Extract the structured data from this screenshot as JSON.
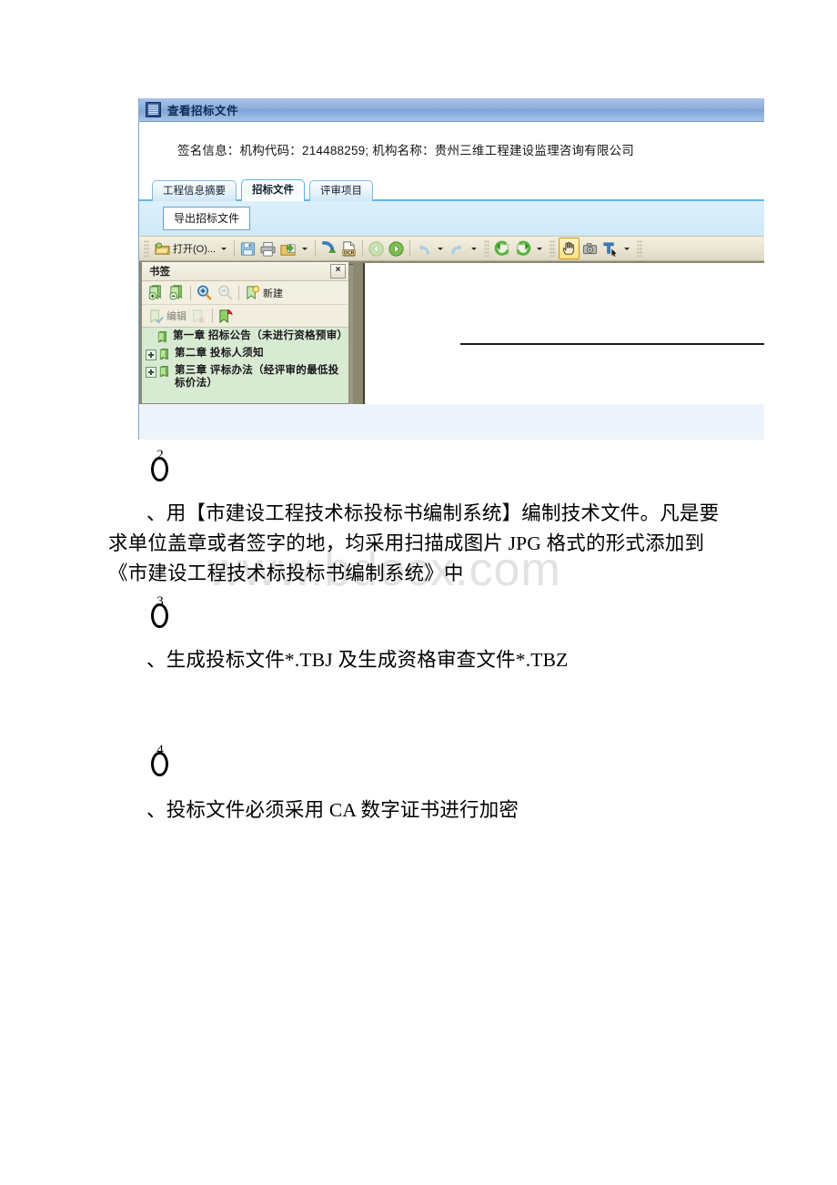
{
  "document": {
    "watermark": "www.bdocx.com",
    "list_items": [
      {
        "marker": "2",
        "text": "、用【市建设工程技术标投标书编制系统】编制技术文件。凡是要求单位盖章或者签字的地，均采用扫描成图片 JPG 格式的形式添加到《市建设工程技术标投标书编制系统》中"
      },
      {
        "marker": "3",
        "text": "、生成投标文件*.TBJ 及生成资格审查文件*.TBZ"
      },
      {
        "marker": "4",
        "text": "、投标文件必须采用 CA 数字证书进行加密"
      }
    ]
  },
  "app": {
    "window": {
      "title": "查看招标文件",
      "icon": "app-window-icon"
    },
    "signature": {
      "label": "签名信息：机构代码：214488259; 机构名称：贵州三维工程建设监理咨询有限公司"
    },
    "tabs": [
      {
        "label": "工程信息摘要",
        "active": false
      },
      {
        "label": "招标文件",
        "active": true
      },
      {
        "label": "评审项目",
        "active": false
      }
    ],
    "export_button": {
      "label": "导出招标文件"
    },
    "reader_toolbar": {
      "open_label": "打开(O)...",
      "items": [
        {
          "name": "open-folder-icon",
          "label": "打开(O)..."
        },
        {
          "name": "save-disk-icon",
          "label": ""
        },
        {
          "name": "printer-icon",
          "label": ""
        },
        {
          "name": "export-package-icon",
          "label": ""
        },
        {
          "name": "email-send-icon",
          "label": ""
        },
        {
          "name": "ocr-icon",
          "label": "OCR"
        },
        {
          "name": "back-arrow-icon",
          "label": ""
        },
        {
          "name": "forward-arrow-icon",
          "label": ""
        },
        {
          "name": "undo-icon",
          "label": ""
        },
        {
          "name": "redo-icon",
          "label": ""
        },
        {
          "name": "rotate-left-icon",
          "label": ""
        },
        {
          "name": "rotate-right-icon",
          "label": ""
        },
        {
          "name": "hand-tool-icon",
          "label": ""
        },
        {
          "name": "snapshot-camera-icon",
          "label": ""
        },
        {
          "name": "text-select-icon",
          "label": ""
        }
      ],
      "ocr_label": "OCR"
    },
    "bookmark_panel": {
      "title": "书签",
      "close_label": "×",
      "tools_row1": [
        {
          "name": "bookmark-add-icon",
          "label": ""
        },
        {
          "name": "bookmark-remove-icon",
          "label": ""
        },
        {
          "name": "zoom-in-icon",
          "label": ""
        },
        {
          "name": "zoom-out-icon",
          "label": ""
        },
        {
          "name": "bookmark-new-icon",
          "label": "新建"
        }
      ],
      "tools_row2": [
        {
          "name": "bookmark-edit-icon",
          "label": "编辑"
        },
        {
          "name": "bookmark-delete-icon",
          "label": ""
        },
        {
          "name": "bookmark-clear-icon",
          "label": ""
        }
      ],
      "new_label": "新建",
      "edit_label": "编辑",
      "tree": [
        {
          "label": "第一章  招标公告（未进行资格预审）",
          "expandable": false
        },
        {
          "label": "第二章  投标人须知",
          "expandable": true
        },
        {
          "label": "第三章  评标办法（经评审的最低投标价法）",
          "expandable": true
        }
      ]
    }
  },
  "colors": {
    "titlebar_blue": "#8fb0dd",
    "tab_accent": "#5fb8e6",
    "toolbar_beige": "#e9e5d2",
    "bookmark_tree_green": "#d9ead3",
    "selected_yellow": "#ffe07c",
    "watermark_gray": "#e2e2e2"
  }
}
